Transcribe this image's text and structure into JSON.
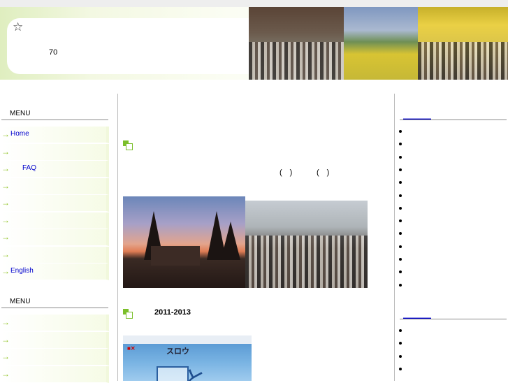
{
  "header": {
    "star": "☆",
    "number": "70"
  },
  "left_sidebar": {
    "menu1_title": "MENU",
    "menu1_items": [
      "Home",
      "",
      "FAQ",
      "",
      "",
      "",
      "",
      "",
      "English"
    ],
    "menu2_title": "MENU",
    "menu2_items": [
      "",
      "",
      "",
      ""
    ]
  },
  "main": {
    "paren1": "(　)",
    "paren2": "(　)",
    "section_title": "2011-2013",
    "book_brand": "スロウ"
  },
  "right_sidebar": {
    "section1_link": "＿＿＿＿",
    "section1_count": 13,
    "section2_link": "＿＿＿＿",
    "section2_count": 4
  },
  "icons": {
    "nav_arrow": "→",
    "star_icon": "star-icon",
    "bullet": "green-square-bullet-icon"
  },
  "colors": {
    "link": "#0000cc",
    "accent_green": "#8dc21f"
  }
}
